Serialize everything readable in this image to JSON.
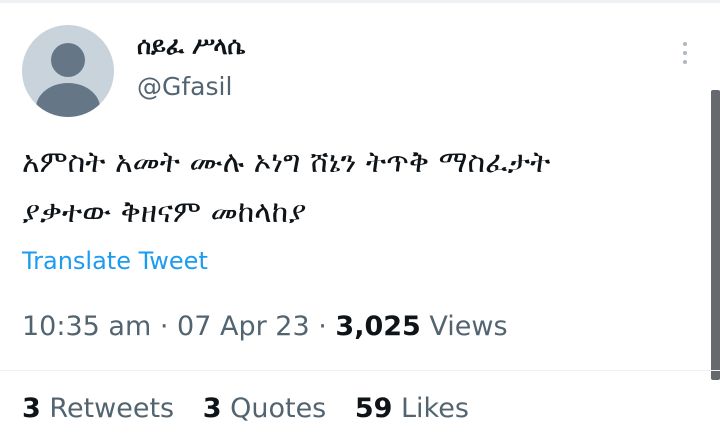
{
  "author": {
    "display_name": "ሰይፈ ሥላሴ",
    "handle": "@Gfasil"
  },
  "tweet": {
    "text": "አምስት አመት ሙሉ ኦነግ ሸኔን ትጥቅ ማስፈታት\nያቃተው ቅዘናም መከላከያ",
    "translate_label": "Translate Tweet",
    "time": "10:35 am",
    "date": "07 Apr 23",
    "separator": "·",
    "views_count": "3,025",
    "views_label": "Views"
  },
  "stats": {
    "retweets_count": "3",
    "retweets_label": "Retweets",
    "quotes_count": "3",
    "quotes_label": "Quotes",
    "likes_count": "59",
    "likes_label": "Likes"
  },
  "icons": {
    "avatar": "default-avatar-icon",
    "more": "more-options-icon"
  },
  "colors": {
    "accent": "#1d9bf0",
    "secondary_text": "#536471",
    "primary_text": "#0f1419"
  }
}
